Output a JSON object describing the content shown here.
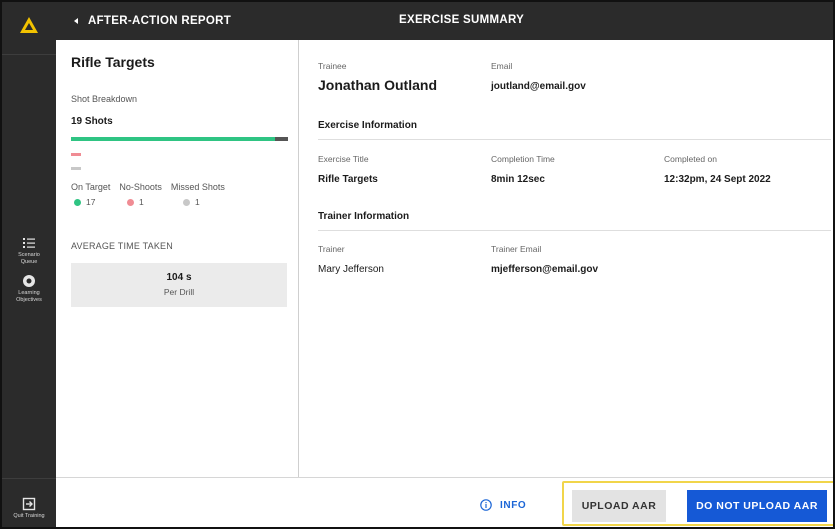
{
  "rail": {
    "logo_icon": "warning-triangle-icon",
    "items": [
      {
        "icon": "list-icon",
        "label_line1": "Scenario",
        "label_line2": "Queue"
      },
      {
        "icon": "target-icon",
        "label_line1": "Learning",
        "label_line2": "Objectives"
      }
    ],
    "quit": {
      "icon": "exit-icon",
      "label": "Quit Training"
    }
  },
  "topbar": {
    "back_label": "AFTER-ACTION REPORT",
    "title": "EXERCISE SUMMARY"
  },
  "left_panel": {
    "title": "Rifle Targets",
    "subtitle": "Shot Breakdown",
    "total_shots": "19 Shots",
    "on_target_fraction": 0.94,
    "legend": {
      "on_target_label": "On Target",
      "no_shoots_label": "No-Shoots",
      "missed_label": "Missed Shots",
      "on_target_value": "17",
      "no_shoots_value": "1",
      "missed_value": "1"
    },
    "avg_label": "AVERAGE TIME TAKEN",
    "avg_value": "104 s",
    "avg_unit": "Per Drill"
  },
  "content": {
    "trainee_label": "Trainee",
    "trainee_name": "Jonathan Outland",
    "email_label": "Email",
    "email_value": "joutland@email.gov",
    "exercise_section": "Exercise Information",
    "exercise_title_label": "Exercise Title",
    "exercise_title_value": "Rifle Targets",
    "completion_label": "Completion Time",
    "completion_value": "8min 12sec",
    "completed_on_label": "Completed on",
    "completed_on_value": "12:32pm, 24 Sept 2022",
    "trainer_section": "Trainer Information",
    "trainer_label": "Trainer",
    "trainer_value": "Mary Jefferson",
    "trainer_email_label": "Trainer Email",
    "trainer_email_value": "mjefferson@email.gov"
  },
  "footer": {
    "info_label": "INFO",
    "upload_label": "UPLOAD AAR",
    "no_upload_label": "DO NOT UPLOAD AAR"
  },
  "colors": {
    "on_target": "#2fc483",
    "no_shoots": "#f08c94",
    "missed": "#c8c8c8",
    "accent_blue": "#1559d6",
    "highlight": "#f1d54a"
  }
}
